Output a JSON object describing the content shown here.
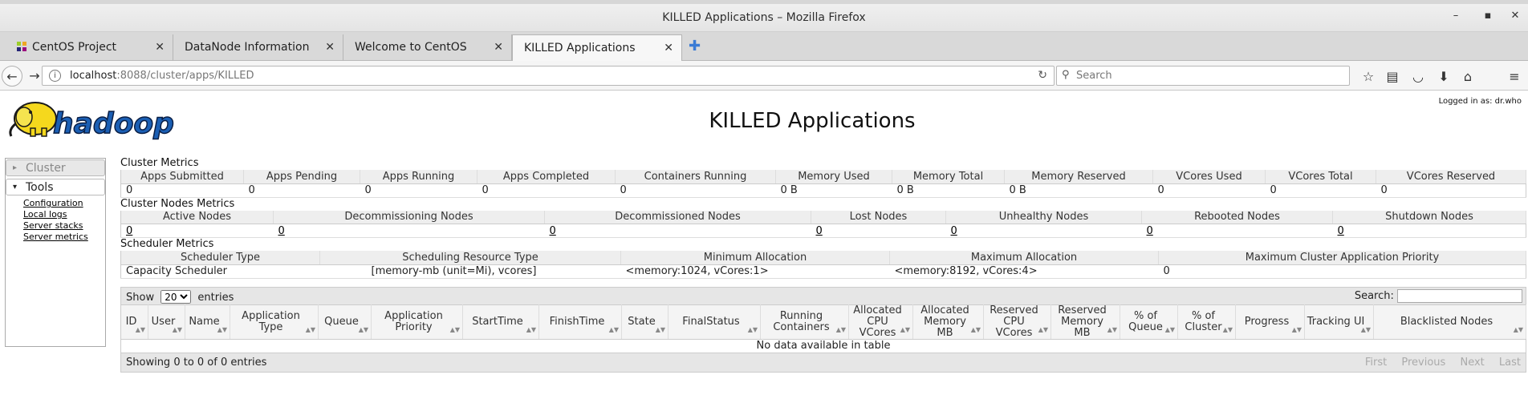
{
  "window": {
    "title": "KILLED Applications – Mozilla Firefox"
  },
  "tabs": [
    {
      "label": "CentOS Project",
      "active": false
    },
    {
      "label": "DataNode Information",
      "active": false
    },
    {
      "label": "Welcome to CentOS",
      "active": false
    },
    {
      "label": "KILLED Applications",
      "active": true
    }
  ],
  "nav": {
    "url_host": "localhost",
    "url_path": ":8088/cluster/apps/KILLED",
    "search_placeholder": "Search"
  },
  "page": {
    "logged_in": "Logged in as: dr.who",
    "title": "KILLED Applications"
  },
  "sidebar": {
    "cluster_label": "Cluster",
    "tools_label": "Tools",
    "tools_links": [
      "Configuration",
      "Local logs",
      "Server stacks",
      "Server metrics"
    ]
  },
  "cluster_metrics": {
    "title": "Cluster Metrics",
    "headers": [
      "Apps Submitted",
      "Apps Pending",
      "Apps Running",
      "Apps Completed",
      "Containers Running",
      "Memory Used",
      "Memory Total",
      "Memory Reserved",
      "VCores Used",
      "VCores Total",
      "VCores Reserved"
    ],
    "values": [
      "0",
      "0",
      "0",
      "0",
      "0",
      "0 B",
      "0 B",
      "0 B",
      "0",
      "0",
      "0"
    ]
  },
  "cluster_nodes_metrics": {
    "title": "Cluster Nodes Metrics",
    "headers": [
      "Active Nodes",
      "Decommissioning Nodes",
      "Decommissioned Nodes",
      "Lost Nodes",
      "Unhealthy Nodes",
      "Rebooted Nodes",
      "Shutdown Nodes"
    ],
    "values": [
      "0",
      "0",
      "0",
      "0",
      "0",
      "0",
      "0"
    ]
  },
  "scheduler_metrics": {
    "title": "Scheduler Metrics",
    "headers": [
      "Scheduler Type",
      "Scheduling Resource Type",
      "Minimum Allocation",
      "Maximum Allocation",
      "Maximum Cluster Application Priority"
    ],
    "values": [
      "Capacity Scheduler",
      "[memory-mb (unit=Mi), vcores]",
      "<memory:1024, vCores:1>",
      "<memory:8192, vCores:4>",
      "0"
    ]
  },
  "apps_table": {
    "show_label": "Show",
    "entries_value": "20",
    "entries_label": "entries",
    "search_label": "Search:",
    "headers": [
      "ID",
      "User",
      "Name",
      "Application Type",
      "Queue",
      "Application Priority",
      "StartTime",
      "FinishTime",
      "State",
      "FinalStatus",
      "Running Containers",
      "Allocated CPU VCores",
      "Allocated Memory MB",
      "Reserved CPU VCores",
      "Reserved Memory MB",
      "% of Queue",
      "% of Cluster",
      "Progress",
      "Tracking UI",
      "Blacklisted Nodes"
    ],
    "empty_message": "No data available in table",
    "info": "Showing 0 to 0 of 0 entries",
    "pager": [
      "First",
      "Previous",
      "Next",
      "Last"
    ]
  }
}
